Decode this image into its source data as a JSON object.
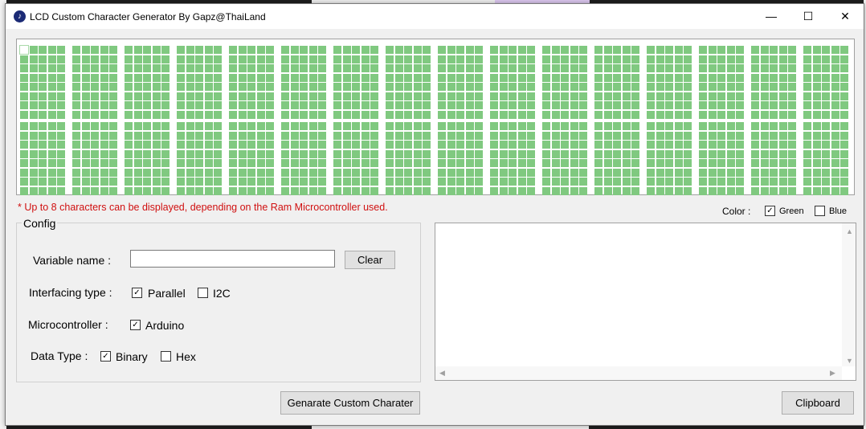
{
  "window": {
    "title": "LCD Custom Character Generator By Gapz@ThaiLand",
    "icon": "app-icon",
    "controls": {
      "minimize": "—",
      "maximize": "☐",
      "close": "✕"
    }
  },
  "grid": {
    "characters_per_row": 16,
    "rows": 2,
    "pixel_columns": 5,
    "pixel_rows": 8,
    "on_color": "#80c980"
  },
  "warning": "* Up to 8 characters can be displayed, depending on the Ram Microcontroller used.",
  "color": {
    "label": "Color :",
    "green": {
      "label": "Green",
      "checked": true
    },
    "blue": {
      "label": "Blue",
      "checked": false
    }
  },
  "config": {
    "legend": "Config",
    "variable_name": {
      "label": "Variable name :",
      "value": "",
      "clear_label": "Clear"
    },
    "interfacing": {
      "label": "Interfacing type :",
      "parallel": {
        "label": "Parallel",
        "checked": true
      },
      "i2c": {
        "label": "I2C",
        "checked": false
      }
    },
    "microcontroller": {
      "label": "Microcontroller :",
      "arduino": {
        "label": "Arduino",
        "checked": true
      }
    },
    "data_type": {
      "label": "Data Type :",
      "binary": {
        "label": "Binary",
        "checked": true
      },
      "hex": {
        "label": "Hex",
        "checked": false
      }
    }
  },
  "actions": {
    "generate_label": "Genarate Custom Charater",
    "clipboard_label": "Clipboard"
  },
  "output": {
    "text": ""
  }
}
